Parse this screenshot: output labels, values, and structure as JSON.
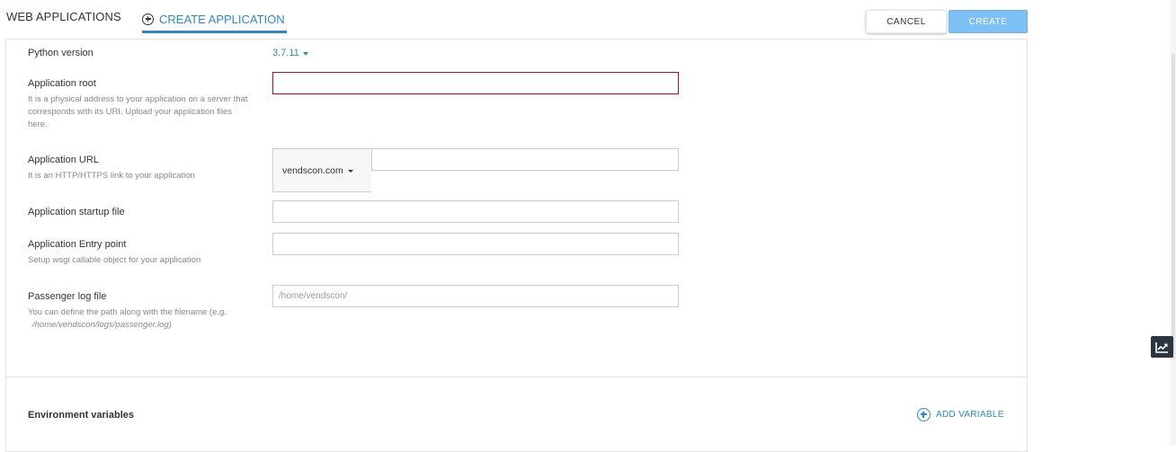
{
  "tabs": {
    "web_applications": "WEB APPLICATIONS",
    "create_application": "CREATE APPLICATION"
  },
  "actions": {
    "cancel": "CANCEL",
    "create": "CREATE"
  },
  "form": {
    "python_version": {
      "label": "Python version",
      "value": "3.7.11"
    },
    "app_root": {
      "label": "Application root",
      "hint": "It is a physical address to your application on a server that corresponds with its URI. Upload your application files here.",
      "value": ""
    },
    "app_url": {
      "label": "Application URL",
      "hint": "It is an HTTP/HTTPS link to your application",
      "domain": "vendscon.com",
      "value": ""
    },
    "startup_file": {
      "label": "Application startup file",
      "value": ""
    },
    "entry_point": {
      "label": "Application Entry point",
      "hint": "Setup wsgi callable object for your application",
      "value": ""
    },
    "passenger_log": {
      "label": "Passenger log file",
      "hint_line1": "You can define the path along with the filename (e.g.",
      "hint_line2": "/home/vendscon/logs/passenger.log)",
      "placeholder": "/home/vendscon/"
    }
  },
  "env": {
    "title": "Environment variables",
    "add_label": "ADD VARIABLE"
  },
  "colors": {
    "accent": "#2c88c9",
    "create_button": "#7cc0f5",
    "error_border": "#d0021b"
  },
  "icons": {
    "create_tab": "plus-circle-icon",
    "add_variable": "plus-circle-icon",
    "side_widget": "trending-chart-icon"
  }
}
